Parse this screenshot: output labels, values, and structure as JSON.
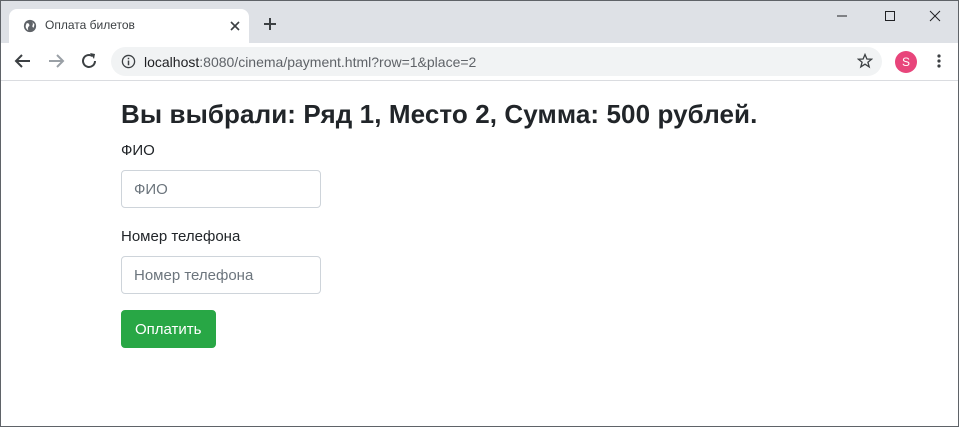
{
  "browser": {
    "tab_title": "Оплата билетов",
    "url_host": "localhost",
    "url_rest": ":8080/cinema/payment.html?row=1&place=2",
    "avatar_letter": "S"
  },
  "page": {
    "heading": "Вы выбрали: Ряд 1, Место 2, Сумма: 500 рублей.",
    "name_label": "ФИО",
    "name_placeholder": "ФИО",
    "phone_label": "Номер телефона",
    "phone_placeholder": "Номер телефона",
    "pay_button": "Оплатить"
  },
  "colors": {
    "tabstrip": "#dee1e6",
    "button": "#28a745",
    "avatar": "#e8457b"
  },
  "icons": [
    "globe-icon",
    "close-icon",
    "plus-icon",
    "minimize-icon",
    "maximize-icon",
    "window-close-icon",
    "back-icon",
    "forward-icon",
    "reload-icon",
    "info-icon",
    "star-icon",
    "menu-icon"
  ]
}
